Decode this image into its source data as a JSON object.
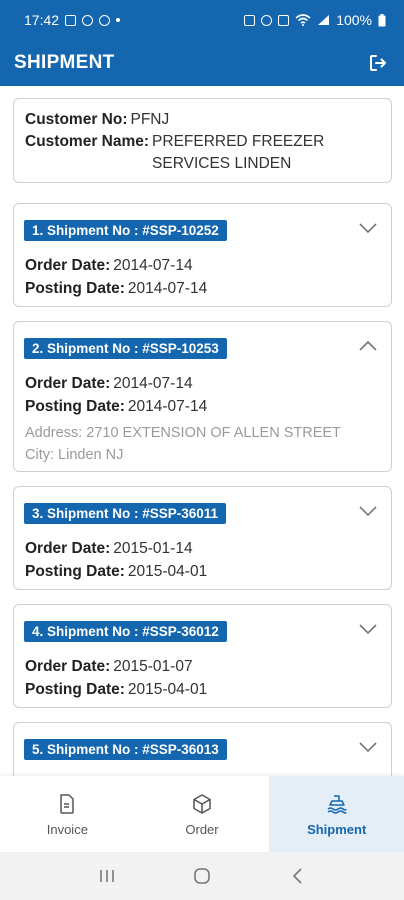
{
  "status_bar": {
    "time": "17:42",
    "battery": "100%"
  },
  "app_bar": {
    "title": "SHIPMENT"
  },
  "customer": {
    "no_label": "Customer No:",
    "no_value": "PFNJ",
    "name_label": "Customer Name:",
    "name_value": "PREFERRED FREEZER SERVICES LINDEN"
  },
  "shipments": [
    {
      "badge": "1. Shipment No : #SSP-10252",
      "order_label": "Order Date:",
      "order_date": "2014-07-14",
      "posting_label": "Posting Date:",
      "posting_date": "2014-07-14",
      "expanded": false
    },
    {
      "badge": "2. Shipment No : #SSP-10253",
      "order_label": "Order Date:",
      "order_date": "2014-07-14",
      "posting_label": "Posting Date:",
      "posting_date": "2014-07-14",
      "address": "Address: 2710 EXTENSION OF ALLEN STREET",
      "city": "City: Linden NJ",
      "expanded": true
    },
    {
      "badge": "3. Shipment No : #SSP-36011",
      "order_label": "Order Date:",
      "order_date": "2015-01-14",
      "posting_label": "Posting Date:",
      "posting_date": "2015-04-01",
      "expanded": false
    },
    {
      "badge": "4. Shipment No : #SSP-36012",
      "order_label": "Order Date:",
      "order_date": "2015-01-07",
      "posting_label": "Posting Date:",
      "posting_date": "2015-04-01",
      "expanded": false
    },
    {
      "badge": "5. Shipment No : #SSP-36013",
      "expanded": false
    }
  ],
  "bottom_nav": {
    "invoice": "Invoice",
    "order": "Order",
    "shipment": "Shipment"
  },
  "colors": {
    "primary": "#1467ae",
    "active_tab_bg": "#e3eef6"
  }
}
